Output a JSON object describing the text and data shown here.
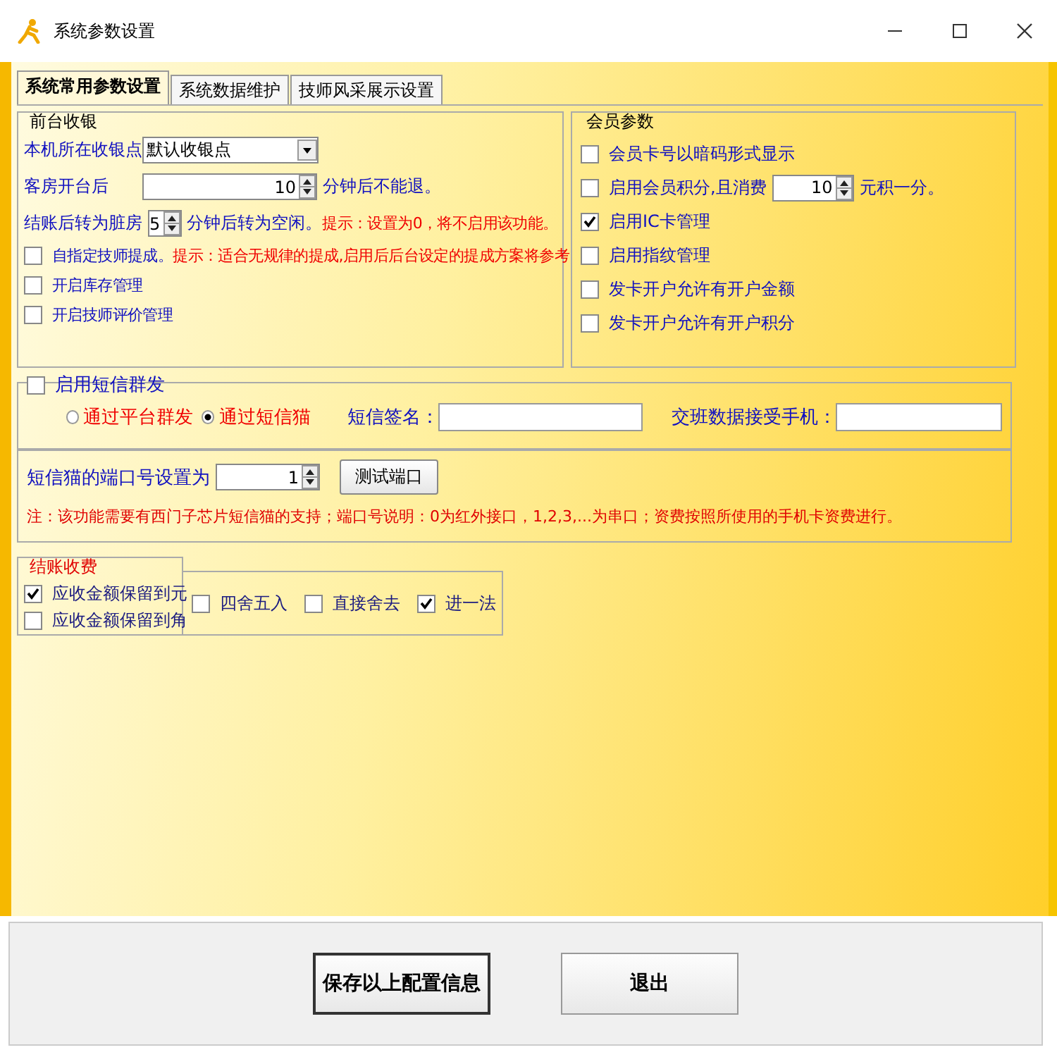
{
  "window": {
    "title": "系统参数设置"
  },
  "tabs": [
    {
      "label": "系统常用参数设置",
      "selected": true
    },
    {
      "label": "系统数据维护",
      "selected": false
    },
    {
      "label": "技师风采展示设置",
      "selected": false
    }
  ],
  "front_desk": {
    "title": "前台收银",
    "cashier_point": {
      "label": "本机所在收银点",
      "value": "默认收银点"
    },
    "room_open": {
      "label": "客房开台后",
      "value": "10",
      "suffix": "分钟后不能退。"
    },
    "checkout_dirty": {
      "label": "结账后转为脏房",
      "value": "5",
      "suffix": "分钟后转为空闲。",
      "hint": "提示：设置为0，将不启用该功能。"
    },
    "options": [
      {
        "label": "自指定技师提成。",
        "hint": "提示：适合无规律的提成,启用后后台设定的提成方案将参考",
        "checked": false
      },
      {
        "label": "开启库存管理",
        "checked": false
      },
      {
        "label": "开启技师评价管理",
        "checked": false
      }
    ]
  },
  "member": {
    "title": "会员参数",
    "options": [
      {
        "kind": "checkbox",
        "label": "会员卡号以暗码形式显示",
        "checked": false
      },
      {
        "kind": "spin",
        "label": "启用会员积分,且消费",
        "value": "10",
        "suffix": "元积一分。",
        "checked": false
      },
      {
        "kind": "checkbox",
        "label": "启用IC卡管理",
        "checked": true
      },
      {
        "kind": "checkbox",
        "label": "启用指纹管理",
        "checked": false
      },
      {
        "kind": "checkbox",
        "label": "发卡开户允许有开户金额",
        "checked": false
      },
      {
        "kind": "checkbox",
        "label": "发卡开户允许有开户积分",
        "checked": false
      }
    ]
  },
  "sms": {
    "title": "启用短信群发",
    "checked": false,
    "radios": [
      {
        "label": "通过平台群发",
        "selected": false
      },
      {
        "label": "通过短信猫",
        "selected": true
      }
    ],
    "fields": [
      {
        "label": "短信签名："
      },
      {
        "label": "交班数据接受手机："
      }
    ],
    "port": {
      "label": "短信猫的端口号设置为",
      "value": "1",
      "button": "测试端口"
    },
    "note": "注：该功能需要有西门子芯片短信猫的支持；端口号说明：0为红外接口，1,2,3,...为串口；资费按照所使用的手机卡资费进行。"
  },
  "checkout": {
    "title": "结账收费",
    "precision": [
      {
        "label": "应收金额保留到元",
        "checked": true
      },
      {
        "label": "应收金额保留到角",
        "checked": false
      }
    ],
    "rounding": [
      {
        "label": "四舍五入",
        "checked": false
      },
      {
        "label": "直接舍去",
        "checked": false
      },
      {
        "label": "进一法",
        "checked": true
      }
    ]
  },
  "buttons": [
    {
      "label": "保存以上配置信息",
      "focused": true
    },
    {
      "label": "退出",
      "focused": false
    }
  ]
}
